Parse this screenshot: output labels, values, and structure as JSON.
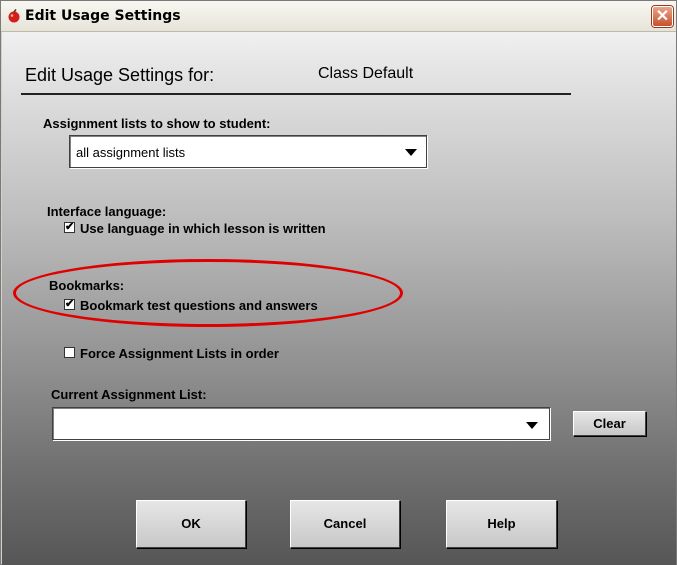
{
  "window": {
    "title": "Edit Usage Settings",
    "icon": "red-apple-icon",
    "close_icon": "close-icon"
  },
  "header": {
    "title": "Edit Usage Settings for:",
    "value": "Class Default"
  },
  "assignment_lists": {
    "label": "Assignment lists to show to student:",
    "selected": "all assignment lists"
  },
  "interface_language": {
    "label": "Interface language:",
    "checkbox_label": "Use language in which lesson is written",
    "checked": true
  },
  "bookmarks": {
    "label": "Bookmarks:",
    "checkbox_label": "Bookmark test questions and answers",
    "checked": true,
    "highlight_color": "#e00000"
  },
  "force_order": {
    "checkbox_label": "Force Assignment Lists in order",
    "checked": false
  },
  "current_list": {
    "label": "Current Assignment List:",
    "selected": "",
    "clear_label": "Clear"
  },
  "footer": {
    "ok_label": "OK",
    "cancel_label": "Cancel",
    "help_label": "Help"
  }
}
